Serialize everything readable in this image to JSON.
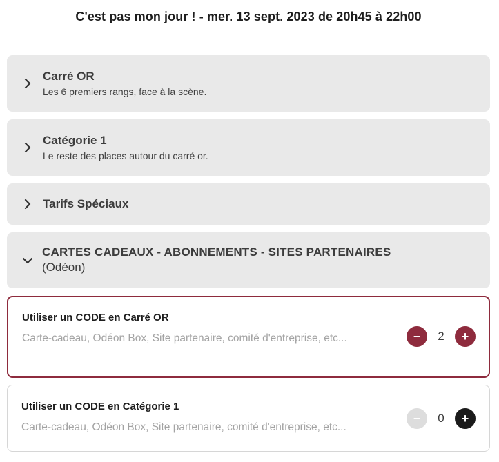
{
  "header": {
    "title": "C'est pas mon jour ! - mer. 13 sept. 2023 de 20h45 à 22h00"
  },
  "categories": [
    {
      "title": "Carré OR",
      "subtitle": "Les 6 premiers rangs, face à la scène."
    },
    {
      "title": "Catégorie 1",
      "subtitle": "Le reste des places autour du carré or."
    },
    {
      "title": "Tarifs Spéciaux"
    }
  ],
  "gift_section": {
    "title": "CARTES CADEAUX - ABONNEMENTS - SITES PARTENAIRES",
    "subtitle": "(Odéon)"
  },
  "codes": [
    {
      "title": "Utiliser un CODE en Carré OR",
      "placeholder": "Carte-cadeau, Odéon Box, Site partenaire, comité d'entreprise, etc...",
      "quantity": "2",
      "minus": "−",
      "plus": "+"
    },
    {
      "title": "Utiliser un CODE en Catégorie 1",
      "placeholder": "Carte-cadeau, Odéon Box, Site partenaire, comité d'entreprise, etc...",
      "quantity": "0",
      "minus": "−",
      "plus": "+"
    }
  ],
  "colors": {
    "accent": "#8e2b3d",
    "panel": "#e9e9e9",
    "dark_button": "#1b1b1b",
    "disabled_button": "#dddddd"
  },
  "icons": {
    "collapsed": "chevron-right-icon",
    "expanded": "chevron-down-icon"
  }
}
